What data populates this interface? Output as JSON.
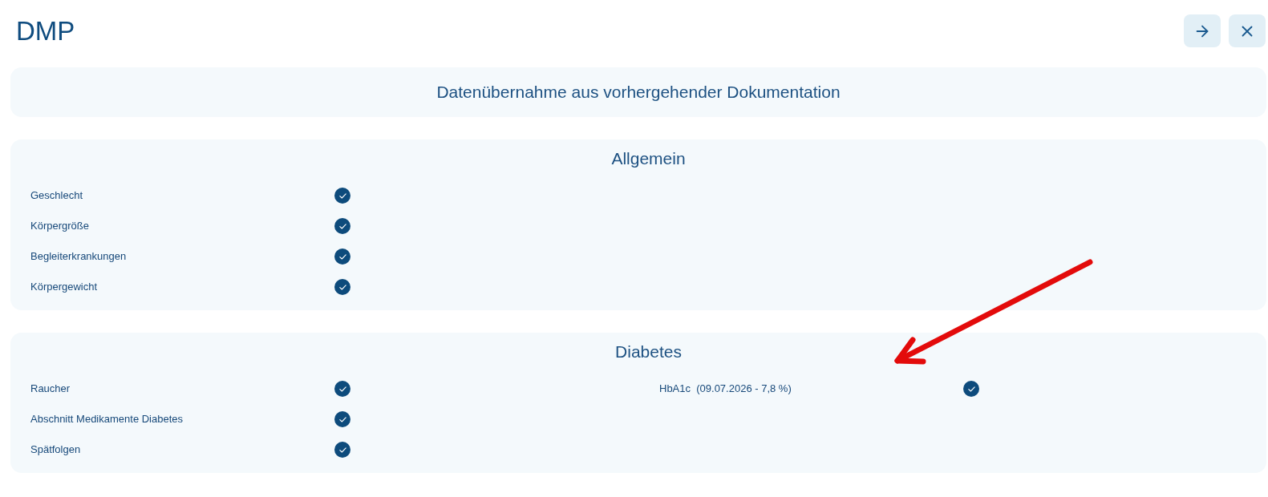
{
  "title": "DMP",
  "banner": {
    "text": "Datenübernahme aus vorhergehender Dokumentation"
  },
  "sections": [
    {
      "title": "Allgemein",
      "columns": [
        [
          {
            "label": "Geschlecht",
            "checked": true
          },
          {
            "label": "Körpergröße",
            "checked": true
          },
          {
            "label": "Begleiterkrankungen",
            "checked": true
          },
          {
            "label": "Körpergewicht",
            "checked": true
          }
        ]
      ]
    },
    {
      "title": "Diabetes",
      "columns": [
        [
          {
            "label": "Raucher",
            "checked": true
          },
          {
            "label": "Abschnitt Medikamente Diabetes",
            "checked": true
          },
          {
            "label": "Spätfolgen",
            "checked": true
          }
        ],
        [
          {
            "label": "HbA1c  (09.07.2026 - 7,8 %)",
            "checked": true
          }
        ]
      ]
    }
  ]
}
